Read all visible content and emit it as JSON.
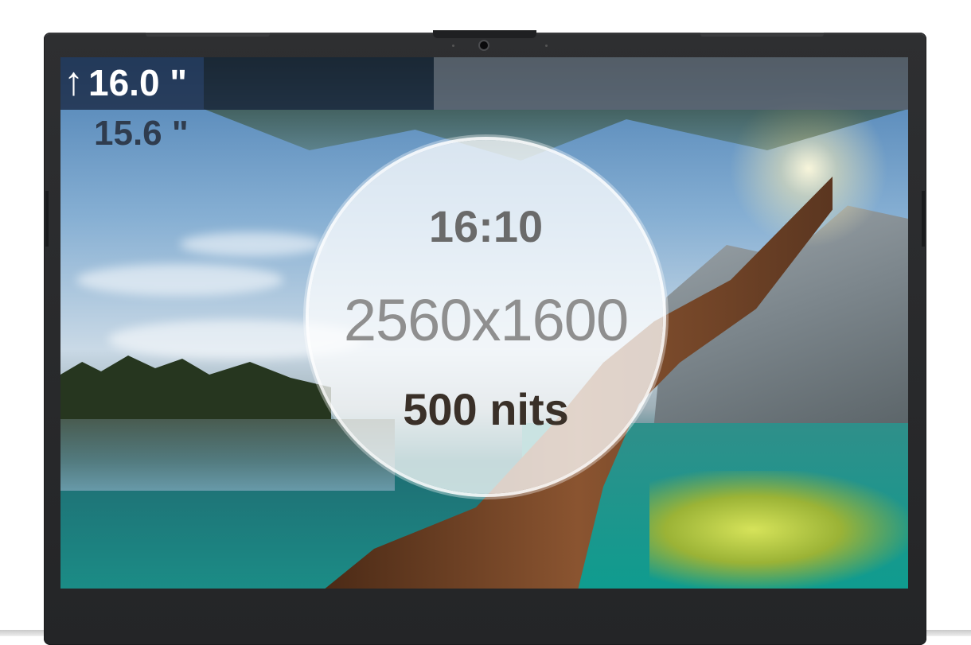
{
  "display": {
    "size_new": "16.0 \"",
    "size_old": "15.6 \"",
    "aspect_ratio": "16:10",
    "resolution": "2560x1600",
    "brightness": "500 nits"
  },
  "icons": {
    "size_increase": "up-arrow-icon"
  },
  "colors": {
    "bezel": "#2a2b2d",
    "overlay_strip": "#141e37",
    "circle_fill": "#ffffff"
  }
}
